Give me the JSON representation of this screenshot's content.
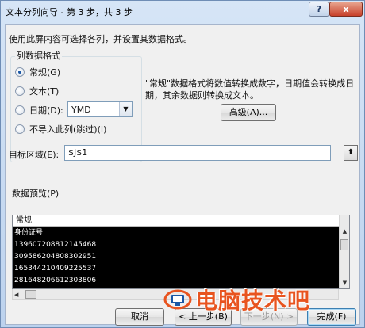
{
  "window": {
    "title": "文本分列向导 - 第 3 步，共 3 步",
    "help_label": "?",
    "close_label": "x"
  },
  "instruction": "使用此屏内容可选择各列，并设置其数据格式。",
  "column_format": {
    "legend": "列数据格式",
    "options": [
      {
        "label": "常规(G)",
        "selected": true
      },
      {
        "label": "文本(T)",
        "selected": false
      },
      {
        "label": "日期(D):",
        "selected": false
      },
      {
        "label": "不导入此列(跳过)(I)",
        "selected": false
      }
    ],
    "date_format": "YMD",
    "dropdown_arrow": "▼"
  },
  "note": "\"常规\"数据格式将数值转换成数字，日期值会转换成日期，其余数据则转换成文本。",
  "advanced_button": "高级(A)...",
  "destination": {
    "label": "目标区域(E):",
    "value": "$J$1",
    "collapse_icon": "⬆"
  },
  "preview": {
    "label": "数据预览(P)",
    "header": "常规",
    "rows": [
      "身份证号",
      "139607208812145468",
      "309586204808302951",
      "165344210409225537",
      "281648206612303806"
    ]
  },
  "scroll": {
    "up": "▲",
    "down": "▼",
    "left": "◀"
  },
  "buttons": {
    "cancel": "取消",
    "back": "< 上一步(B)",
    "next": "下一步(N) >",
    "finish": "完成(F)"
  },
  "watermark": {
    "text": "电脑技术吧"
  },
  "colors": {
    "accent": "#1a57a5",
    "watermark": "#e8541f",
    "preview_bg": "#000000"
  }
}
